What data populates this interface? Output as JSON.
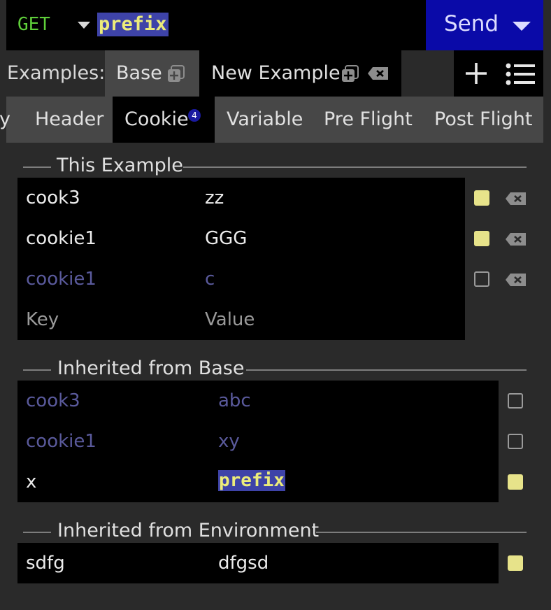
{
  "request": {
    "method": "GET",
    "url": "prefix",
    "send_label": "Send"
  },
  "examples": {
    "label": "Examples:",
    "items": [
      {
        "label": "Base"
      },
      {
        "label": "New Example"
      }
    ]
  },
  "tabs": [
    {
      "label": "y"
    },
    {
      "label": "Header"
    },
    {
      "label": "Cookie",
      "badge": "4"
    },
    {
      "label": "Variable"
    },
    {
      "label": "Pre Flight"
    },
    {
      "label": "Post Flight"
    }
  ],
  "sections": {
    "this_example": {
      "title": "This Example",
      "rows": [
        {
          "key": "cook3",
          "value": "zz",
          "enabled": true
        },
        {
          "key": "cookie1",
          "value": "GGG",
          "enabled": true
        },
        {
          "key": "cookie1",
          "value": "c",
          "enabled": false
        }
      ],
      "key_placeholder": "Key",
      "value_placeholder": "Value"
    },
    "inherited_base": {
      "title": "Inherited from Base",
      "rows": [
        {
          "key": "cook3",
          "value": "abc",
          "enabled": false
        },
        {
          "key": "cookie1",
          "value": "xy",
          "enabled": false
        },
        {
          "key": "x",
          "value": "prefix",
          "enabled": true
        }
      ]
    },
    "inherited_env": {
      "title": "Inherited from Environment",
      "rows": [
        {
          "key": "sdfg",
          "value": "dfgsd",
          "enabled": true
        }
      ]
    }
  },
  "colors": {
    "accent": "#0a0aa8",
    "checkbox_on": "#e7e38a",
    "highlight_bg": "#3e43a8",
    "highlight_fg": "#ecec7a",
    "method": "#5fcf3a"
  }
}
